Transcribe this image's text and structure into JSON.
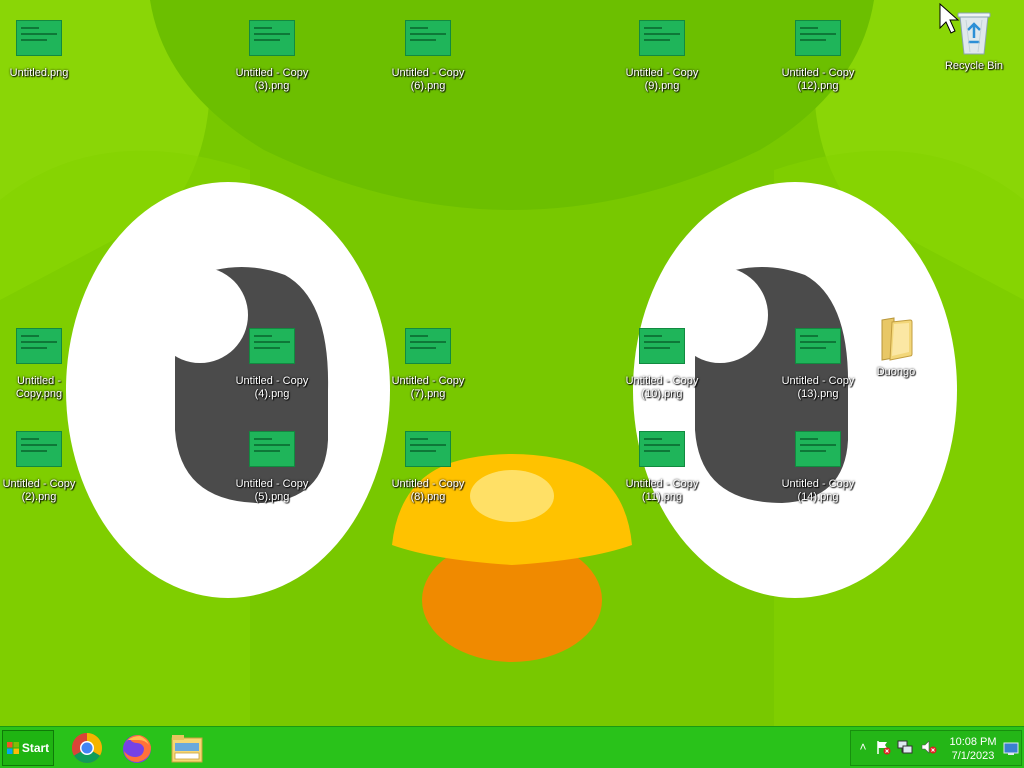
{
  "desktop": {
    "icons": [
      {
        "label": "Untitled.png"
      },
      {
        "label": "Untitled - Copy (3).png"
      },
      {
        "label": "Untitled - Copy (6).png"
      },
      {
        "label": "Untitled - Copy (9).png"
      },
      {
        "label": "Untitled - Copy (12).png"
      },
      {
        "label": "Recycle Bin"
      },
      {
        "label": "Untitled - Copy.png"
      },
      {
        "label": "Untitled - Copy (4).png"
      },
      {
        "label": "Untitled - Copy (7).png"
      },
      {
        "label": "Untitled - Copy (10).png"
      },
      {
        "label": "Untitled - Copy (13).png"
      },
      {
        "label": "Duongo"
      },
      {
        "label": "Untitled - Copy (2).png"
      },
      {
        "label": "Untitled - Copy (5).png"
      },
      {
        "label": "Untitled - Copy (8).png"
      },
      {
        "label": "Untitled - Copy (11).png"
      },
      {
        "label": "Untitled - Copy (14).png"
      }
    ]
  },
  "taskbar": {
    "start_label": "Start",
    "pinned": [
      "chrome-icon",
      "firefox-icon",
      "file-explorer-icon"
    ],
    "tray_icons": [
      "show-hidden-icons-chevron",
      "action-center-flag-icon",
      "network-icon",
      "volume-muted-icon",
      "show-desktop-icon"
    ],
    "clock": {
      "time": "10:08 PM",
      "date": "7/1/2023"
    }
  },
  "colors": {
    "wallpaper_green": "#78c800",
    "taskbar_green": "#29c21a",
    "thumb_green": "#1fb55a"
  }
}
